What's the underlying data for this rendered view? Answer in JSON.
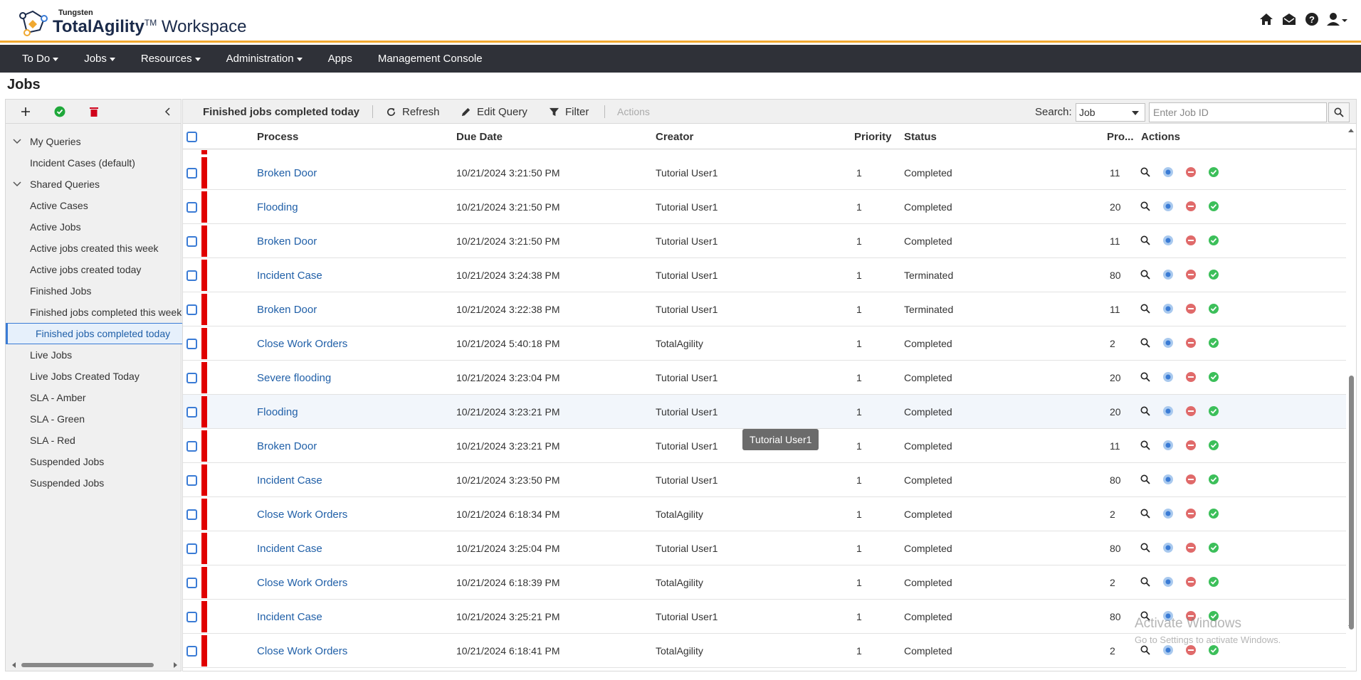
{
  "header": {
    "vendor": "Tungsten",
    "product_bold": "TotalAgility",
    "trademark": "TM",
    "product_suffix": " Workspace",
    "icons": [
      "home-icon",
      "inbox-icon",
      "help-icon",
      "user-icon"
    ]
  },
  "nav": {
    "items": [
      {
        "label": "To Do",
        "dropdown": true
      },
      {
        "label": "Jobs",
        "dropdown": true
      },
      {
        "label": "Resources",
        "dropdown": true
      },
      {
        "label": "Administration",
        "dropdown": true
      },
      {
        "label": "Apps",
        "dropdown": false
      },
      {
        "label": "Management Console",
        "dropdown": false
      }
    ]
  },
  "page": {
    "title": "Jobs"
  },
  "sidebar": {
    "groups": [
      {
        "label": "My Queries",
        "items": [
          "Incident Cases (default)"
        ]
      },
      {
        "label": "Shared Queries",
        "items": [
          "Active Cases",
          "Active Jobs",
          "Active jobs created this week",
          "Active jobs created today",
          "Finished Jobs",
          "Finished jobs completed this week",
          "Finished jobs completed today",
          "Live Jobs",
          "Live Jobs Created Today",
          "SLA - Amber",
          "SLA - Green",
          "SLA - Red",
          "Suspended Jobs",
          "Suspended Jobs"
        ]
      }
    ],
    "selected": "Finished jobs completed today"
  },
  "toolbar": {
    "query_title": "Finished jobs completed today",
    "refresh_label": "Refresh",
    "edit_query_label": "Edit Query",
    "filter_label": "Filter",
    "actions_label": "Actions",
    "search_label": "Search:",
    "search_type": "Job",
    "search_placeholder": "Enter Job ID"
  },
  "grid": {
    "columns": [
      "Process",
      "Due Date",
      "Creator",
      "Priority",
      "Status",
      "Pro...",
      "Actions"
    ],
    "rows": [
      {
        "process": "Broken Door",
        "due": "10/21/2024 3:21:50 PM",
        "creator": "Tutorial User1",
        "priority": "1",
        "status": "Completed",
        "progress": "11"
      },
      {
        "process": "Flooding",
        "due": "10/21/2024 3:21:50 PM",
        "creator": "Tutorial User1",
        "priority": "1",
        "status": "Completed",
        "progress": "20"
      },
      {
        "process": "Broken Door",
        "due": "10/21/2024 3:21:50 PM",
        "creator": "Tutorial User1",
        "priority": "1",
        "status": "Completed",
        "progress": "11"
      },
      {
        "process": "Incident Case",
        "due": "10/21/2024 3:24:38 PM",
        "creator": "Tutorial User1",
        "priority": "1",
        "status": "Terminated",
        "progress": "80"
      },
      {
        "process": "Broken Door",
        "due": "10/21/2024 3:22:38 PM",
        "creator": "Tutorial User1",
        "priority": "1",
        "status": "Terminated",
        "progress": "11"
      },
      {
        "process": "Close Work Orders",
        "due": "10/21/2024 5:40:18 PM",
        "creator": "TotalAgility",
        "priority": "1",
        "status": "Completed",
        "progress": "2"
      },
      {
        "process": "Severe flooding",
        "due": "10/21/2024 3:23:04 PM",
        "creator": "Tutorial User1",
        "priority": "1",
        "status": "Completed",
        "progress": "20"
      },
      {
        "process": "Flooding",
        "due": "10/21/2024 3:23:21 PM",
        "creator": "Tutorial User1",
        "priority": "1",
        "status": "Completed",
        "progress": "20"
      },
      {
        "process": "Broken Door",
        "due": "10/21/2024 3:23:21 PM",
        "creator": "Tutorial User1",
        "priority": "1",
        "status": "Completed",
        "progress": "11"
      },
      {
        "process": "Incident Case",
        "due": "10/21/2024 3:23:50 PM",
        "creator": "Tutorial User1",
        "priority": "1",
        "status": "Completed",
        "progress": "80"
      },
      {
        "process": "Close Work Orders",
        "due": "10/21/2024 6:18:34 PM",
        "creator": "TotalAgility",
        "priority": "1",
        "status": "Completed",
        "progress": "2"
      },
      {
        "process": "Incident Case",
        "due": "10/21/2024 3:25:04 PM",
        "creator": "Tutorial User1",
        "priority": "1",
        "status": "Completed",
        "progress": "80"
      },
      {
        "process": "Close Work Orders",
        "due": "10/21/2024 6:18:39 PM",
        "creator": "TotalAgility",
        "priority": "1",
        "status": "Completed",
        "progress": "2"
      },
      {
        "process": "Incident Case",
        "due": "10/21/2024 3:25:21 PM",
        "creator": "Tutorial User1",
        "priority": "1",
        "status": "Completed",
        "progress": "80"
      },
      {
        "process": "Close Work Orders",
        "due": "10/21/2024 6:18:41 PM",
        "creator": "TotalAgility",
        "priority": "1",
        "status": "Completed",
        "progress": "2"
      }
    ],
    "row_actions": [
      "search-icon",
      "info-icon",
      "delete-icon",
      "complete-icon"
    ],
    "hover_row_index": 7
  },
  "tooltip": {
    "text": "Tutorial User1"
  },
  "watermark": {
    "line1": "Activate Windows",
    "line2": "Go to Settings to activate Windows."
  },
  "colors": {
    "nav_bg": "#2f3138",
    "accent": "#f0a830",
    "link": "#2160a8",
    "priority_bar": "#e00000"
  }
}
